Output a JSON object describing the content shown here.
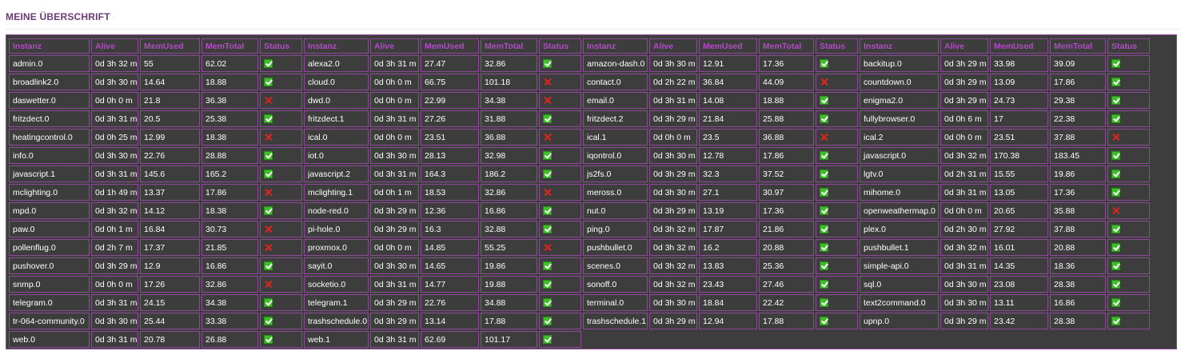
{
  "heading": "MEINE ÜBERSCHRIFT",
  "columns": [
    "Instanz",
    "Alive",
    "MemUsed",
    "MemTotal",
    "Status"
  ],
  "status_colors": {
    "ok": "#3fbe2a",
    "fail": "#e0241c"
  },
  "rows": [
    [
      {
        "instanz": "admin.0",
        "alive": "0d 3h 32 m",
        "memused": "55",
        "memtotal": "62.02",
        "status": "ok"
      },
      {
        "instanz": "alexa2.0",
        "alive": "0d 3h 31 m",
        "memused": "27.47",
        "memtotal": "32.86",
        "status": "ok"
      },
      {
        "instanz": "amazon-dash.0",
        "alive": "0d 3h 30 m",
        "memused": "12.91",
        "memtotal": "17.36",
        "status": "ok"
      },
      {
        "instanz": "backitup.0",
        "alive": "0d 3h 29 m",
        "memused": "33.98",
        "memtotal": "39.09",
        "status": "ok"
      }
    ],
    [
      {
        "instanz": "broadlink2.0",
        "alive": "0d 3h 30 m",
        "memused": "14.64",
        "memtotal": "18.88",
        "status": "ok"
      },
      {
        "instanz": "cloud.0",
        "alive": "0d 0h 0 m",
        "memused": "66.75",
        "memtotal": "101.18",
        "status": "fail"
      },
      {
        "instanz": "contact.0",
        "alive": "0d 2h 22 m",
        "memused": "36.84",
        "memtotal": "44.09",
        "status": "fail"
      },
      {
        "instanz": "countdown.0",
        "alive": "0d 3h 29 m",
        "memused": "13.09",
        "memtotal": "17.86",
        "status": "ok"
      }
    ],
    [
      {
        "instanz": "daswetter.0",
        "alive": "0d 0h 0 m",
        "memused": "21.8",
        "memtotal": "36.38",
        "status": "fail"
      },
      {
        "instanz": "dwd.0",
        "alive": "0d 0h 0 m",
        "memused": "22.99",
        "memtotal": "34.38",
        "status": "fail"
      },
      {
        "instanz": "email.0",
        "alive": "0d 3h 31 m",
        "memused": "14.08",
        "memtotal": "18.88",
        "status": "ok"
      },
      {
        "instanz": "enigma2.0",
        "alive": "0d 3h 29 m",
        "memused": "24.73",
        "memtotal": "29.38",
        "status": "ok"
      }
    ],
    [
      {
        "instanz": "fritzdect.0",
        "alive": "0d 3h 31 m",
        "memused": "20.5",
        "memtotal": "25.38",
        "status": "ok"
      },
      {
        "instanz": "fritzdect.1",
        "alive": "0d 3h 31 m",
        "memused": "27.26",
        "memtotal": "31.88",
        "status": "ok"
      },
      {
        "instanz": "fritzdect.2",
        "alive": "0d 3h 29 m",
        "memused": "21.84",
        "memtotal": "25.88",
        "status": "ok"
      },
      {
        "instanz": "fullybrowser.0",
        "alive": "0d 0h 6 m",
        "memused": "17",
        "memtotal": "22.38",
        "status": "ok"
      }
    ],
    [
      {
        "instanz": "heatingcontrol.0",
        "alive": "0d 0h 25 m",
        "memused": "12.99",
        "memtotal": "18.38",
        "status": "fail"
      },
      {
        "instanz": "ical.0",
        "alive": "0d 0h 0 m",
        "memused": "23.51",
        "memtotal": "36.88",
        "status": "fail"
      },
      {
        "instanz": "ical.1",
        "alive": "0d 0h 0 m",
        "memused": "23.5",
        "memtotal": "36.88",
        "status": "fail"
      },
      {
        "instanz": "ical.2",
        "alive": "0d 0h 0 m",
        "memused": "23.51",
        "memtotal": "37.88",
        "status": "fail"
      }
    ],
    [
      {
        "instanz": "info.0",
        "alive": "0d 3h 30 m",
        "memused": "22.76",
        "memtotal": "28.88",
        "status": "ok"
      },
      {
        "instanz": "iot.0",
        "alive": "0d 3h 30 m",
        "memused": "28.13",
        "memtotal": "32.98",
        "status": "ok"
      },
      {
        "instanz": "iqontrol.0",
        "alive": "0d 3h 30 m",
        "memused": "12.78",
        "memtotal": "17.86",
        "status": "ok"
      },
      {
        "instanz": "javascript.0",
        "alive": "0d 3h 32 m",
        "memused": "170.38",
        "memtotal": "183.45",
        "status": "ok"
      }
    ],
    [
      {
        "instanz": "javascript.1",
        "alive": "0d 3h 31 m",
        "memused": "145.6",
        "memtotal": "165.2",
        "status": "ok"
      },
      {
        "instanz": "javascript.2",
        "alive": "0d 3h 31 m",
        "memused": "164.3",
        "memtotal": "186.2",
        "status": "ok"
      },
      {
        "instanz": "js2fs.0",
        "alive": "0d 3h 29 m",
        "memused": "32.3",
        "memtotal": "37.52",
        "status": "ok"
      },
      {
        "instanz": "lgtv.0",
        "alive": "0d 2h 31 m",
        "memused": "15.55",
        "memtotal": "19.86",
        "status": "ok"
      }
    ],
    [
      {
        "instanz": "mclighting.0",
        "alive": "0d 1h 49 m",
        "memused": "13.37",
        "memtotal": "17.86",
        "status": "fail"
      },
      {
        "instanz": "mclighting.1",
        "alive": "0d 0h 1 m",
        "memused": "18.53",
        "memtotal": "32.86",
        "status": "fail"
      },
      {
        "instanz": "meross.0",
        "alive": "0d 3h 30 m",
        "memused": "27.1",
        "memtotal": "30.97",
        "status": "ok"
      },
      {
        "instanz": "mihome.0",
        "alive": "0d 3h 31 m",
        "memused": "13.05",
        "memtotal": "17.36",
        "status": "ok"
      }
    ],
    [
      {
        "instanz": "mpd.0",
        "alive": "0d 3h 32 m",
        "memused": "14.12",
        "memtotal": "18.38",
        "status": "ok"
      },
      {
        "instanz": "node-red.0",
        "alive": "0d 3h 29 m",
        "memused": "12.36",
        "memtotal": "16.86",
        "status": "ok"
      },
      {
        "instanz": "nut.0",
        "alive": "0d 3h 29 m",
        "memused": "13.19",
        "memtotal": "17.36",
        "status": "ok"
      },
      {
        "instanz": "openweathermap.0",
        "alive": "0d 0h 0 m",
        "memused": "20.65",
        "memtotal": "35.88",
        "status": "fail"
      }
    ],
    [
      {
        "instanz": "paw.0",
        "alive": "0d 0h 1 m",
        "memused": "16.84",
        "memtotal": "30.73",
        "status": "fail"
      },
      {
        "instanz": "pi-hole.0",
        "alive": "0d 3h 29 m",
        "memused": "16.3",
        "memtotal": "32.88",
        "status": "ok"
      },
      {
        "instanz": "ping.0",
        "alive": "0d 3h 32 m",
        "memused": "17.87",
        "memtotal": "21.86",
        "status": "ok"
      },
      {
        "instanz": "plex.0",
        "alive": "0d 2h 30 m",
        "memused": "27.92",
        "memtotal": "37.88",
        "status": "ok"
      }
    ],
    [
      {
        "instanz": "pollenflug.0",
        "alive": "0d 2h 7 m",
        "memused": "17.37",
        "memtotal": "21.85",
        "status": "fail"
      },
      {
        "instanz": "proxmox.0",
        "alive": "0d 0h 0 m",
        "memused": "14.85",
        "memtotal": "55.25",
        "status": "fail"
      },
      {
        "instanz": "pushbullet.0",
        "alive": "0d 3h 32 m",
        "memused": "16.2",
        "memtotal": "20.88",
        "status": "ok"
      },
      {
        "instanz": "pushbullet.1",
        "alive": "0d 3h 32 m",
        "memused": "16.01",
        "memtotal": "20.88",
        "status": "ok"
      }
    ],
    [
      {
        "instanz": "pushover.0",
        "alive": "0d 3h 29 m",
        "memused": "12.9",
        "memtotal": "16.86",
        "status": "ok"
      },
      {
        "instanz": "sayit.0",
        "alive": "0d 3h 30 m",
        "memused": "14.65",
        "memtotal": "19.86",
        "status": "ok"
      },
      {
        "instanz": "scenes.0",
        "alive": "0d 3h 32 m",
        "memused": "13.83",
        "memtotal": "25.36",
        "status": "ok"
      },
      {
        "instanz": "simple-api.0",
        "alive": "0d 3h 31 m",
        "memused": "14.35",
        "memtotal": "18.36",
        "status": "ok"
      }
    ],
    [
      {
        "instanz": "snmp.0",
        "alive": "0d 0h 0 m",
        "memused": "17.26",
        "memtotal": "32.86",
        "status": "fail"
      },
      {
        "instanz": "socketio.0",
        "alive": "0d 3h 31 m",
        "memused": "14.77",
        "memtotal": "19.88",
        "status": "ok"
      },
      {
        "instanz": "sonoff.0",
        "alive": "0d 3h 32 m",
        "memused": "23.43",
        "memtotal": "27.46",
        "status": "ok"
      },
      {
        "instanz": "sql.0",
        "alive": "0d 3h 30 m",
        "memused": "23.08",
        "memtotal": "28.38",
        "status": "ok"
      }
    ],
    [
      {
        "instanz": "telegram.0",
        "alive": "0d 3h 31 m",
        "memused": "24.15",
        "memtotal": "34.38",
        "status": "ok"
      },
      {
        "instanz": "telegram.1",
        "alive": "0d 3h 29 m",
        "memused": "22.76",
        "memtotal": "34.88",
        "status": "ok"
      },
      {
        "instanz": "terminal.0",
        "alive": "0d 3h 30 m",
        "memused": "18.84",
        "memtotal": "22.42",
        "status": "ok"
      },
      {
        "instanz": "text2command.0",
        "alive": "0d 3h 30 m",
        "memused": "13.11",
        "memtotal": "16.86",
        "status": "ok"
      }
    ],
    [
      {
        "instanz": "tr-064-community.0",
        "alive": "0d 3h 30 m",
        "memused": "25.44",
        "memtotal": "33.38",
        "status": "ok"
      },
      {
        "instanz": "trashschedule.0",
        "alive": "0d 3h 29 m",
        "memused": "13.14",
        "memtotal": "17.88",
        "status": "ok"
      },
      {
        "instanz": "trashschedule.1",
        "alive": "0d 3h 29 m",
        "memused": "12.94",
        "memtotal": "17.88",
        "status": "ok"
      },
      {
        "instanz": "upnp.0",
        "alive": "0d 3h 29 m",
        "memused": "23.42",
        "memtotal": "28.38",
        "status": "ok"
      }
    ],
    [
      {
        "instanz": "web.0",
        "alive": "0d 3h 31 m",
        "memused": "20.78",
        "memtotal": "26.88",
        "status": "ok"
      },
      {
        "instanz": "web.1",
        "alive": "0d 3h 31 m",
        "memused": "62.69",
        "memtotal": "101.17",
        "status": "ok"
      },
      null,
      null
    ]
  ]
}
